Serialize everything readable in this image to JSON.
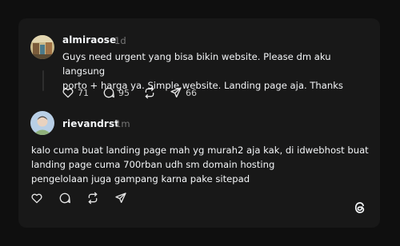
{
  "post": {
    "username": "almiraose",
    "time": "1d",
    "text": "Guys need urgent yang bisa bikin website. Please dm aku langsung\nporto + harga ya. Simple website. Landing page aja. Thanks",
    "likes": "71",
    "replies": "95",
    "shares": "66"
  },
  "reply": {
    "username": "rievandrst",
    "time": "1m",
    "text": "kalo cuma buat landing page mah yg murah2 aja kak, di idwebhost buat\nlanding page cuma 700rban udh sm domain hosting\npengelolaan juga gampang karna pake sitepad"
  },
  "icons": {
    "like": "heart-icon",
    "reply": "comment-icon",
    "repost": "repost-icon",
    "share": "send-icon",
    "brand": "threads-logo-icon"
  },
  "colors": {
    "background": "#0f0f0f",
    "card": "#181818",
    "text": "#f3f5f7",
    "muted": "#777777"
  }
}
